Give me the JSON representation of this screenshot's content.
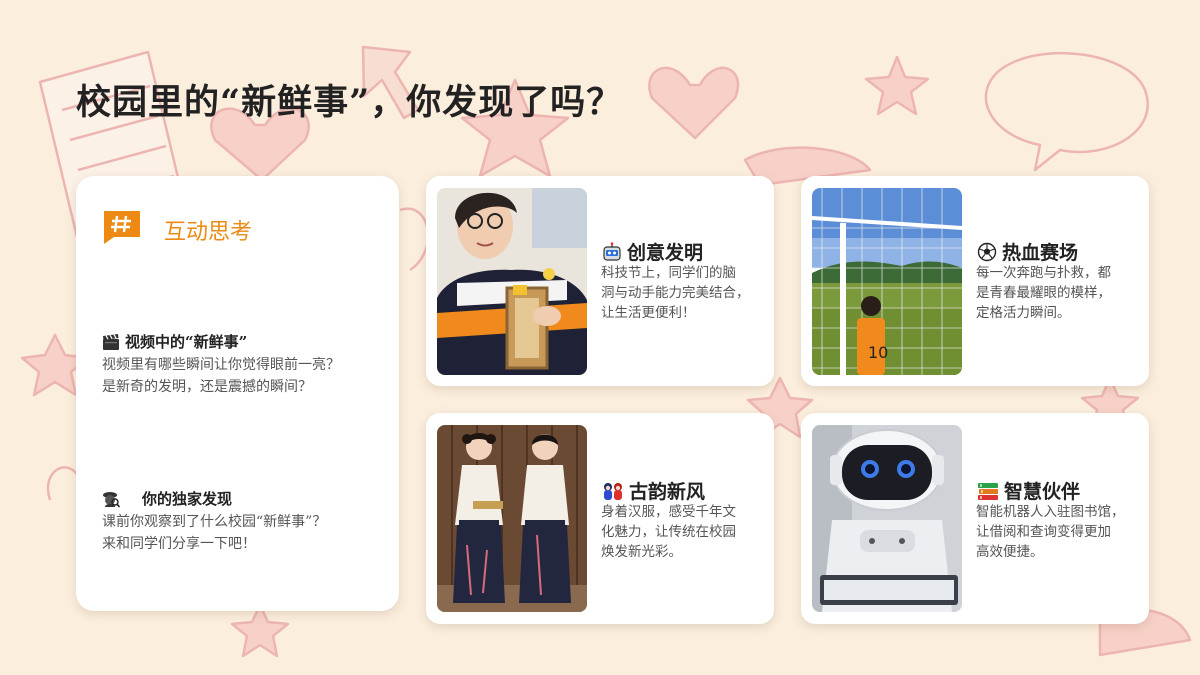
{
  "slide": {
    "title": "校园里的“新鲜事”，你发现了吗？",
    "accent_color": "#ec8a14",
    "background_color": "#fbeedd"
  },
  "left_panel": {
    "badge_icon": "hash-icon",
    "heading": "互动思考",
    "prompts": [
      {
        "icon": "clapperboard-icon",
        "title": "视频中的“新鲜事”",
        "lines": [
          "视频里有哪些瞬间让你觉得眼前一亮？",
          "是新奇的发明，还是震撼的瞬间？"
        ]
      },
      {
        "icon": "detective-icon",
        "title": "你的独家发现",
        "lines": [
          "课前你观察到了什么校园“新鲜事”？",
          "来和同学们分享一下吧！"
        ]
      }
    ]
  },
  "features": [
    {
      "icon": "robot-face-icon",
      "title": "创意发明",
      "lines": [
        "科技节上，同学们的脑",
        "洞与动手能力完美结合，",
        "让生活更便利！"
      ],
      "photo": "student-invention-photo"
    },
    {
      "icon": "soccer-ball-icon",
      "title": "热血赛场",
      "lines": [
        "每一次奔跑与扑救，都",
        "是青春最耀眼的模样，",
        "定格活力瞬间。"
      ],
      "photo": "soccer-field-photo"
    },
    {
      "icon": "dolls-icon",
      "title": "古韵新风",
      "lines": [
        "身着汉服，感受千年文",
        "化魅力，让传统在校园",
        "焕发新光彩。"
      ],
      "photo": "hanfu-children-photo"
    },
    {
      "icon": "books-icon",
      "title": "智慧伙伴",
      "lines": [
        "智能机器人入驻图书馆，",
        "让借阅和查询变得更加",
        "高效便捷。"
      ],
      "photo": "library-robot-photo"
    }
  ]
}
